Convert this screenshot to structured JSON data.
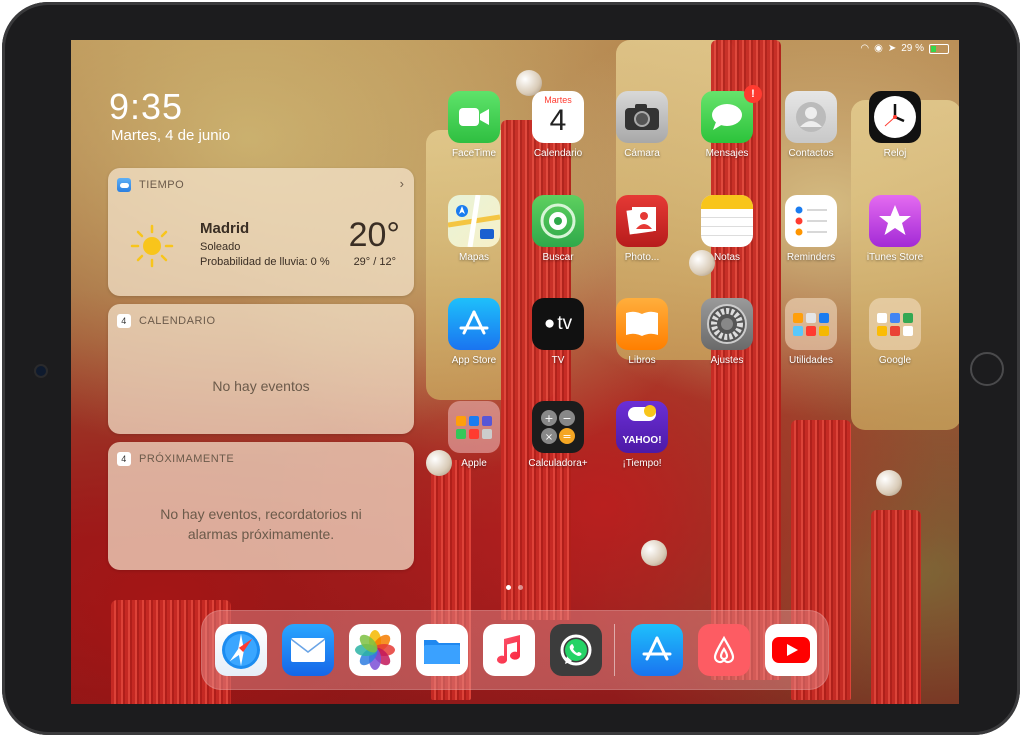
{
  "status_bar": {
    "battery": "29 %"
  },
  "lock": {
    "time": "9:35",
    "date": "Martes, 4 de junio"
  },
  "widgets": {
    "weather": {
      "header": "TIEMPO",
      "city": "Madrid",
      "condition": "Soleado",
      "rain": "Probabilidad de lluvia: 0 %",
      "temp": "20°",
      "range": "29° / 12°"
    },
    "calendar": {
      "header": "CALENDARIO",
      "icon_day": "4",
      "message": "No hay eventos"
    },
    "upcoming": {
      "header": "PRÓXIMAMENTE",
      "icon_day": "4",
      "message_line1": "No hay eventos, recordatorios ni",
      "message_line2": "alarmas próximamente."
    }
  },
  "apps": [
    {
      "label": "FaceTime",
      "icon": "facetime-icon"
    },
    {
      "label": "Calendario",
      "icon": "calendar-icon",
      "month": "Martes",
      "day": "4"
    },
    {
      "label": "Cámara",
      "icon": "camera-icon"
    },
    {
      "label": "Mensajes",
      "icon": "messages-icon",
      "badge": "!"
    },
    {
      "label": "Contactos",
      "icon": "contacts-icon"
    },
    {
      "label": "Reloj",
      "icon": "clock-icon"
    },
    {
      "label": "Mapas",
      "icon": "maps-icon"
    },
    {
      "label": "Buscar",
      "icon": "find-my-icon"
    },
    {
      "label": "Photo...",
      "icon": "photo-booth-icon"
    },
    {
      "label": "Notas",
      "icon": "notes-icon"
    },
    {
      "label": "Reminders",
      "icon": "reminders-icon"
    },
    {
      "label": "iTunes Store",
      "icon": "itunes-store-icon"
    },
    {
      "label": "App Store",
      "icon": "app-store-icon"
    },
    {
      "label": "TV",
      "icon": "apple-tv-icon",
      "text": "tv"
    },
    {
      "label": "Libros",
      "icon": "books-icon"
    },
    {
      "label": "Ajustes",
      "icon": "settings-icon"
    },
    {
      "label": "Utilidades",
      "icon": "utilities-folder-icon"
    },
    {
      "label": "Google",
      "icon": "google-folder-icon"
    },
    {
      "label": "Apple",
      "icon": "apple-folder-icon"
    },
    {
      "label": "Calculadora+",
      "icon": "calculator-icon"
    },
    {
      "label": "¡Tiempo!",
      "icon": "yahoo-weather-icon",
      "text": "YAHOO!"
    }
  ],
  "dock": [
    {
      "name": "safari-icon"
    },
    {
      "name": "mail-icon"
    },
    {
      "name": "photos-icon"
    },
    {
      "name": "files-icon"
    },
    {
      "name": "music-icon"
    },
    {
      "name": "whatsapp-icon"
    },
    {
      "name": "app-store-icon"
    },
    {
      "name": "airbnb-icon"
    },
    {
      "name": "youtube-icon"
    }
  ],
  "colors": {
    "accent_red": "#ff3b30",
    "widget_bg": "#f5e4cd"
  }
}
